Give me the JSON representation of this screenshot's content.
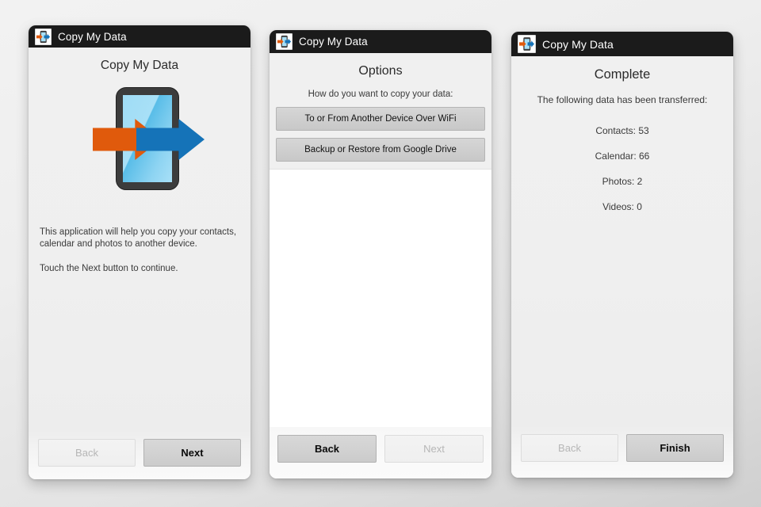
{
  "background": {
    "top_color": "#f2f2f2",
    "bottom_color": "#cfcfcf"
  },
  "app": {
    "name": "Copy My Data",
    "icon": "copy-my-data-icon",
    "titlebar_color": "#1b1b1b",
    "accent_orange": "#e05a0c",
    "accent_blue": "#1573b8",
    "screen_blue": "#9fdcf5"
  },
  "panels": [
    {
      "id": "welcome",
      "titlebar": "Copy My Data",
      "screen_title": "Copy My Data",
      "logo": {
        "name": "copy-my-data-logo",
        "phone_color": "#3c3c3c",
        "screen_color": "#9fdcf5",
        "arrow_in_color": "#e05a0c",
        "arrow_out_color": "#1573b8"
      },
      "description_line1": "This application will help you copy your contacts, calendar and photos to another device.",
      "description_line2": "Touch the Next button to continue.",
      "nav": {
        "back_label": "Back",
        "back_enabled": false,
        "next_label": "Next",
        "next_enabled": true
      }
    },
    {
      "id": "options",
      "titlebar": "Copy My Data",
      "screen_title": "Options",
      "prompt": "How do you want to copy your data:",
      "options": [
        "To or From Another Device Over WiFi",
        "Backup or Restore from Google Drive"
      ],
      "nav": {
        "back_label": "Back",
        "back_enabled": true,
        "next_label": "Next",
        "next_enabled": false
      }
    },
    {
      "id": "complete",
      "titlebar": "Copy My Data",
      "screen_title": "Complete",
      "prompt": "The following data has been transferred:",
      "stats": [
        "Contacts: 53",
        "Calendar: 66",
        "Photos: 2",
        "Videos: 0"
      ],
      "nav": {
        "back_label": "Back",
        "back_enabled": false,
        "finish_label": "Finish",
        "finish_enabled": true
      }
    }
  ]
}
